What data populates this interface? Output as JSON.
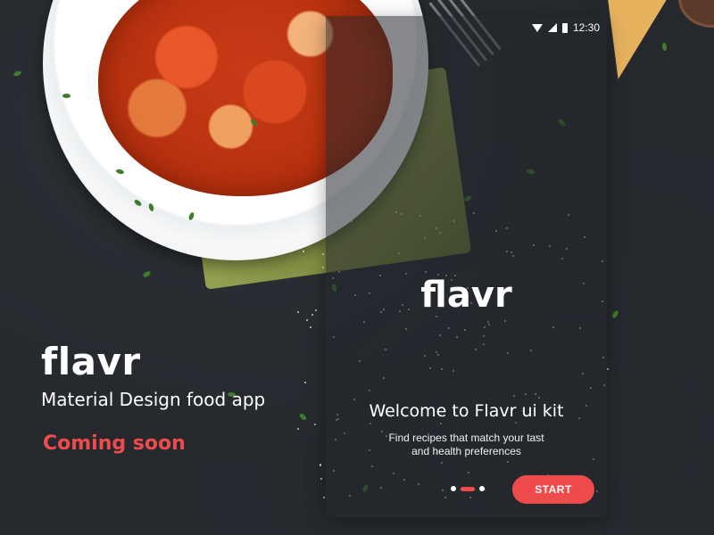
{
  "left_panel": {
    "brand": "flavr",
    "tagline": "Material Design food app",
    "status": "Coming soon"
  },
  "phone": {
    "status_bar": {
      "time": "12:30",
      "icons": [
        "wifi-icon",
        "signal-icon",
        "battery-icon"
      ]
    },
    "brand": "flavr",
    "welcome_title": "Welcome to Flavr ui kit",
    "description_line1": "Find recipes that match your tast",
    "description_line2": "and health preferences",
    "pager": {
      "pages": 3,
      "active_index": 1
    },
    "start_button": "START"
  },
  "colors": {
    "accent": "#f04b4c",
    "background": "#25282d",
    "text": "#ffffff"
  }
}
